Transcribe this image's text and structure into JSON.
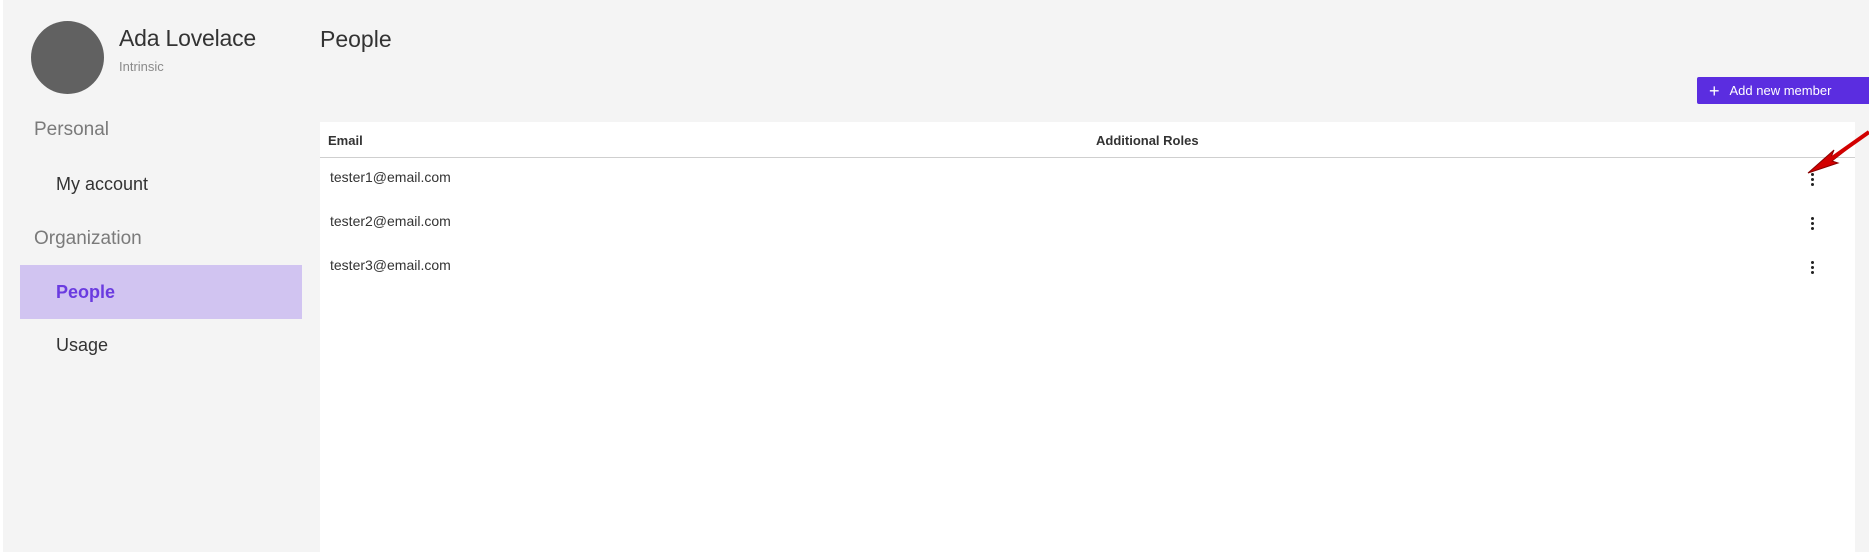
{
  "user": {
    "name": "Ada Lovelace",
    "organization": "Intrinsic"
  },
  "sidebar": {
    "sections": [
      {
        "label": "Personal",
        "items": [
          {
            "label": "My account",
            "selected": false
          }
        ]
      },
      {
        "label": "Organization",
        "items": [
          {
            "label": "People",
            "selected": true
          },
          {
            "label": "Usage",
            "selected": false
          }
        ]
      }
    ]
  },
  "main": {
    "title": "People",
    "add_button_label": "Add new member",
    "columns": [
      "Email",
      "Additional Roles"
    ],
    "rows": [
      {
        "email": "tester1@email.com",
        "roles": ""
      },
      {
        "email": "tester2@email.com",
        "roles": ""
      },
      {
        "email": "tester3@email.com",
        "roles": ""
      }
    ]
  },
  "colors": {
    "accent": "#5b2de0",
    "nav_selected_bg": "#d1c4f1",
    "nav_selected_text": "#6a3be0",
    "annotation_arrow": "#d20000"
  },
  "icons": {
    "add": "plus-icon",
    "row_menu": "more-vert-icon",
    "annotation": "red-arrow-annotation"
  }
}
